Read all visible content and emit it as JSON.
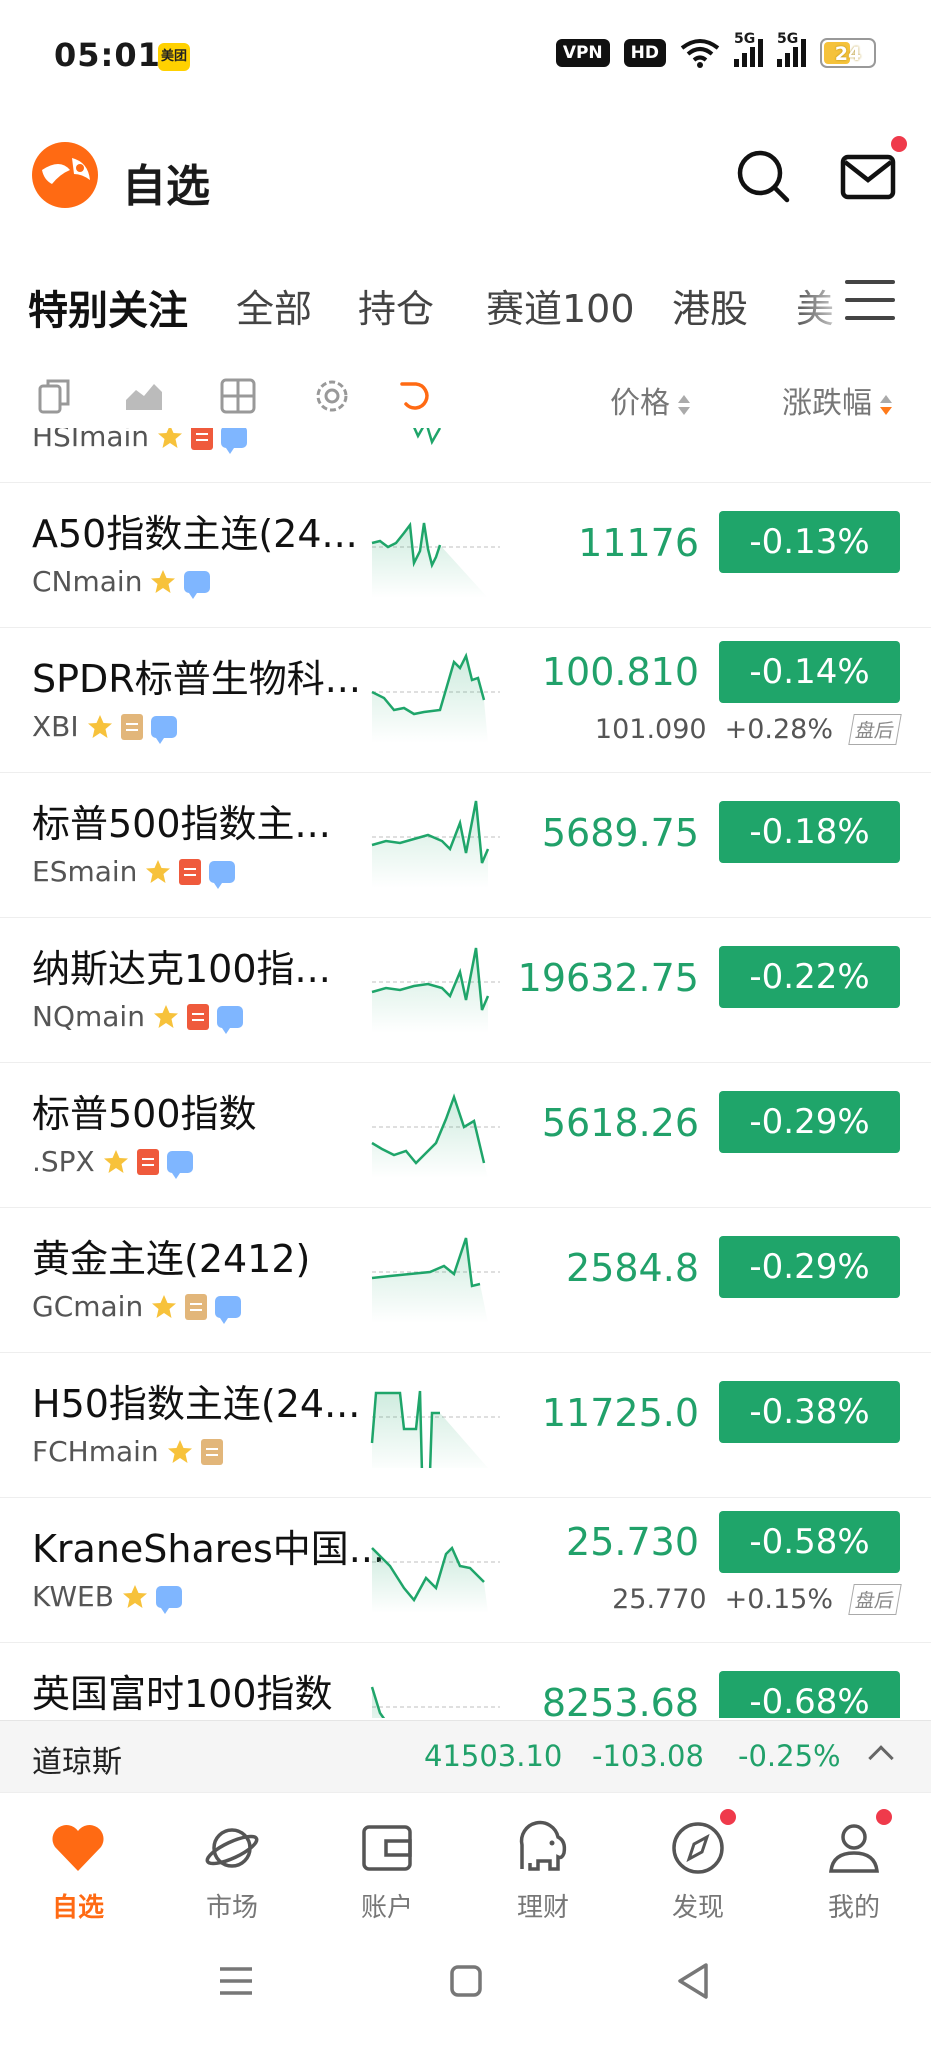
{
  "status_bar": {
    "time": "05:01",
    "meituan": "美团",
    "vpn": "VPN",
    "hd": "HD",
    "network_1": "5G",
    "network_2": "5G",
    "battery": "24"
  },
  "header": {
    "title": "自选"
  },
  "tabs": [
    "特别关注",
    "全部",
    "持仓",
    "赛道100",
    "港股",
    "美"
  ],
  "toolbar": {
    "price_label": "价格",
    "change_label": "涨跌幅"
  },
  "partial_row": {
    "code": "HSImain"
  },
  "rows": [
    {
      "name": "A50指数主连(24...",
      "code": "CNmain",
      "price": "11176",
      "change": "-0.13%",
      "doc": "",
      "chat": true
    },
    {
      "name": "SPDR标普生物科...",
      "code": "XBI",
      "price": "100.810",
      "change": "-0.14%",
      "doc": "tan",
      "chat": true,
      "ext_price": "101.090",
      "ext_change": "+0.28%",
      "ext_tag": "盘后"
    },
    {
      "name": "标普500指数主...",
      "code": "ESmain",
      "price": "5689.75",
      "change": "-0.18%",
      "doc": "red",
      "chat": true
    },
    {
      "name": "纳斯达克100指...",
      "code": "NQmain",
      "price": "19632.75",
      "change": "-0.22%",
      "doc": "red",
      "chat": true
    },
    {
      "name": "标普500指数",
      "code": ".SPX",
      "price": "5618.26",
      "change": "-0.29%",
      "doc": "red",
      "chat": true
    },
    {
      "name": "黄金主连(2412)",
      "code": "GCmain",
      "price": "2584.8",
      "change": "-0.29%",
      "doc": "tan",
      "chat": true
    },
    {
      "name": "H50指数主连(24...",
      "code": "FCHmain",
      "price": "11725.0",
      "change": "-0.38%",
      "doc": "tan",
      "chat": false
    },
    {
      "name": "KraneShares中国...",
      "code": "KWEB",
      "price": "25.730",
      "change": "-0.58%",
      "doc": "",
      "chat": true,
      "ext_price": "25.770",
      "ext_change": "+0.15%",
      "ext_tag": "盘后"
    },
    {
      "name": "英国富时100指数",
      "code": "",
      "price": "8253.68",
      "change": "-0.68%",
      "doc": "",
      "chat": false
    }
  ],
  "ticker": {
    "name": "道琼斯",
    "price": "41503.10",
    "change": "-103.08",
    "change_pct": "-0.25%"
  },
  "bottom_nav": [
    "自选",
    "市场",
    "账户",
    "理财",
    "发现",
    "我的"
  ],
  "colors": {
    "accent": "#ff6a13",
    "down_green": "#1fa56a",
    "badge_red": "#ef3a4b"
  }
}
